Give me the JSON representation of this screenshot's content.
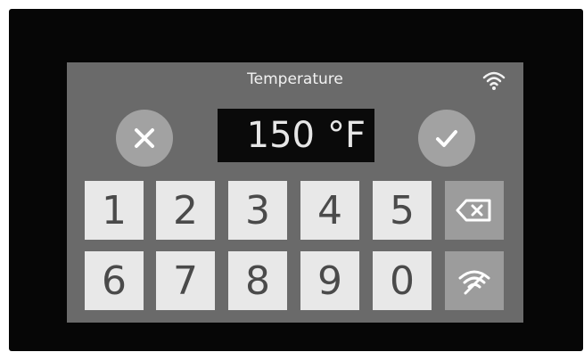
{
  "screen": {
    "title": "Temperature"
  },
  "display": {
    "value": "150",
    "unit": "°F"
  },
  "keypad": {
    "row1": [
      "1",
      "2",
      "3",
      "4",
      "5"
    ],
    "row2": [
      "6",
      "7",
      "8",
      "9",
      "0"
    ]
  },
  "icons": {
    "top_right": "wifi-icon",
    "cancel": "close-icon",
    "confirm": "check-icon",
    "backspace": "backspace-icon",
    "wifi_key": "wifi-icon"
  },
  "colors": {
    "screen_bg": "#6a6a6a",
    "key_bg": "#e8e8e8",
    "func_key_bg": "#9c9c9c",
    "display_bg": "#0a0a0a"
  }
}
